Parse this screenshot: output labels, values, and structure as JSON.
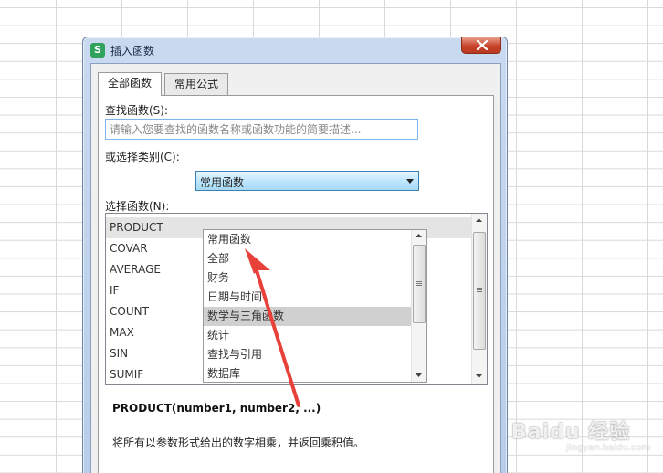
{
  "dialog": {
    "app_icon": "S",
    "title": "插入函数",
    "close_icon": "close-icon"
  },
  "tabs": [
    {
      "label": "全部函数",
      "active": true
    },
    {
      "label": "常用公式",
      "active": false
    }
  ],
  "search": {
    "label": "查找函数(S):",
    "placeholder": "请输入您要查找的函数名称或函数功能的简要描述..."
  },
  "category": {
    "label": "或选择类别(C):",
    "selected": "常用函数",
    "options": [
      "常用函数",
      "全部",
      "财务",
      "日期与时间",
      "数学与三角函数",
      "统计",
      "查找与引用",
      "数据库"
    ],
    "highlighted": "数学与三角函数"
  },
  "functions": {
    "label": "选择函数(N):",
    "items": [
      "PRODUCT",
      "COVAR",
      "AVERAGE",
      "IF",
      "COUNT",
      "MAX",
      "SIN",
      "SUMIF"
    ],
    "selected": "PRODUCT"
  },
  "detail": {
    "signature": "PRODUCT(number1, number2, ...)",
    "description": "将所有以参数形式给出的数字相乘，并返回乘积值。"
  },
  "watermark": {
    "text": "Baidu 经验",
    "url": "jingyan.baidu.com"
  },
  "colors": {
    "annotation_arrow": "#e8413a",
    "select_highlight": "#bee6fd",
    "close_button": "#c9422a"
  }
}
